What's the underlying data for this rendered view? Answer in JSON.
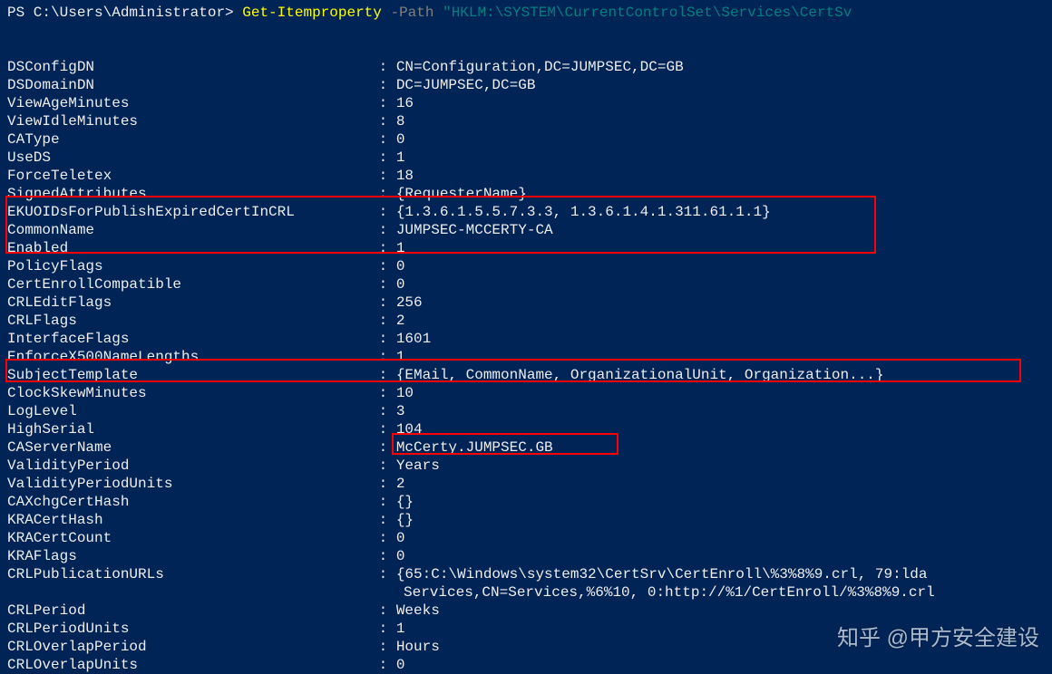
{
  "prompt": {
    "prefix": "PS C:\\Users\\Administrator> ",
    "cmdlet": "Get-Itemproperty",
    "param": " -Path ",
    "string": "\"HKLM:\\SYSTEM\\CurrentControlSet\\Services\\CertSv"
  },
  "properties": [
    {
      "key": "DSConfigDN",
      "value": "CN=Configuration,DC=JUMPSEC,DC=GB"
    },
    {
      "key": "DSDomainDN",
      "value": "DC=JUMPSEC,DC=GB"
    },
    {
      "key": "ViewAgeMinutes",
      "value": "16"
    },
    {
      "key": "ViewIdleMinutes",
      "value": "8"
    },
    {
      "key": "CAType",
      "value": "0"
    },
    {
      "key": "UseDS",
      "value": "1"
    },
    {
      "key": "ForceTeletex",
      "value": "18"
    },
    {
      "key": "SignedAttributes",
      "value": "{RequesterName}"
    },
    {
      "key": "EKUOIDsForPublishExpiredCertInCRL",
      "value": "{1.3.6.1.5.5.7.3.3, 1.3.6.1.4.1.311.61.1.1}"
    },
    {
      "key": "CommonName",
      "value": "JUMPSEC-MCCERTY-CA"
    },
    {
      "key": "Enabled",
      "value": "1"
    },
    {
      "key": "PolicyFlags",
      "value": "0"
    },
    {
      "key": "CertEnrollCompatible",
      "value": "0"
    },
    {
      "key": "CRLEditFlags",
      "value": "256"
    },
    {
      "key": "CRLFlags",
      "value": "2"
    },
    {
      "key": "InterfaceFlags",
      "value": "1601"
    },
    {
      "key": "EnforceX500NameLengths",
      "value": "1"
    },
    {
      "key": "SubjectTemplate",
      "value": "{EMail, CommonName, OrganizationalUnit, Organization...}"
    },
    {
      "key": "ClockSkewMinutes",
      "value": "10"
    },
    {
      "key": "LogLevel",
      "value": "3"
    },
    {
      "key": "HighSerial",
      "value": "104"
    },
    {
      "key": "CAServerName",
      "value": "McCerty.JUMPSEC.GB"
    },
    {
      "key": "ValidityPeriod",
      "value": "Years"
    },
    {
      "key": "ValidityPeriodUnits",
      "value": "2"
    },
    {
      "key": "CAXchgCertHash",
      "value": "{}"
    },
    {
      "key": "KRACertHash",
      "value": "{}"
    },
    {
      "key": "KRACertCount",
      "value": "0"
    },
    {
      "key": "KRAFlags",
      "value": "0"
    },
    {
      "key": "CRLPublicationURLs",
      "value": "{65:C:\\Windows\\system32\\CertSrv\\CertEnroll\\%3%8%9.crl, 79:lda",
      "continuation": "Services,CN=Services,%6%10, 0:http://%1/CertEnroll/%3%8%9.crl"
    },
    {
      "key": "CRLPeriod",
      "value": "Weeks"
    },
    {
      "key": "CRLPeriodUnits",
      "value": "1"
    },
    {
      "key": "CRLOverlapPeriod",
      "value": "Hours"
    },
    {
      "key": "CRLOverlapUnits",
      "value": "0"
    }
  ],
  "watermark": "知乎 @甲方安全建设"
}
